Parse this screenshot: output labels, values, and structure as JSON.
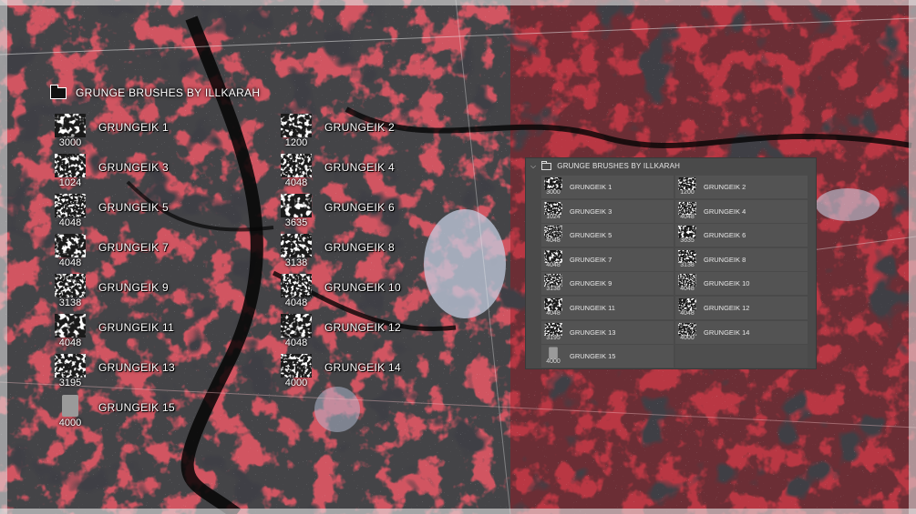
{
  "colors": {
    "accent_red": "#a3161d",
    "panel_bg": "#4a4a4a",
    "cell_bg": "#535353"
  },
  "preview": {
    "title": "GRUNGE BRUSHES BY ILLKARAH",
    "folder_icon": "folder-icon",
    "items": [
      {
        "label": "GRUNGEIK 1",
        "size": "3000"
      },
      {
        "label": "GRUNGEIK 2",
        "size": "1200"
      },
      {
        "label": "GRUNGEIK 3",
        "size": "1024"
      },
      {
        "label": "GRUNGEIK 4",
        "size": "4048"
      },
      {
        "label": "GRUNGEIK 5",
        "size": "4048"
      },
      {
        "label": "GRUNGEIK 6",
        "size": "3635"
      },
      {
        "label": "GRUNGEIK 7",
        "size": "4048"
      },
      {
        "label": "GRUNGEIK 8",
        "size": "3138"
      },
      {
        "label": "GRUNGEIK 9",
        "size": "3138"
      },
      {
        "label": "GRUNGEIK 10",
        "size": "4048"
      },
      {
        "label": "GRUNGEIK 11",
        "size": "4048"
      },
      {
        "label": "GRUNGEIK 12",
        "size": "4048"
      },
      {
        "label": "GRUNGEIK 13",
        "size": "3195"
      },
      {
        "label": "GRUNGEIK 14",
        "size": "4000"
      },
      {
        "label": "GRUNGEIK 15",
        "size": "4000"
      }
    ]
  },
  "panel": {
    "title": "GRUNGE BRUSHES BY ILLKARAH",
    "collapse_icon": "chevron-down-icon",
    "folder_icon": "folder-icon",
    "items": [
      {
        "label": "GRUNGEIK 1",
        "size": "3000"
      },
      {
        "label": "GRUNGEIK 2",
        "size": "1200"
      },
      {
        "label": "GRUNGEIK 3",
        "size": "1024"
      },
      {
        "label": "GRUNGEIK 4",
        "size": "4048"
      },
      {
        "label": "GRUNGEIK 5",
        "size": "4048"
      },
      {
        "label": "GRUNGEIK 6",
        "size": "3635"
      },
      {
        "label": "GRUNGEIK 7",
        "size": "4048"
      },
      {
        "label": "GRUNGEIK 8",
        "size": "3138"
      },
      {
        "label": "GRUNGEIK 9",
        "size": "3138"
      },
      {
        "label": "GRUNGEIK 10",
        "size": "4048"
      },
      {
        "label": "GRUNGEIK 11",
        "size": "4048"
      },
      {
        "label": "GRUNGEIK 12",
        "size": "4048"
      },
      {
        "label": "GRUNGEIK 13",
        "size": "3195"
      },
      {
        "label": "GRUNGEIK 14",
        "size": "4000"
      },
      {
        "label": "GRUNGEIK 15",
        "size": "4000"
      }
    ]
  }
}
